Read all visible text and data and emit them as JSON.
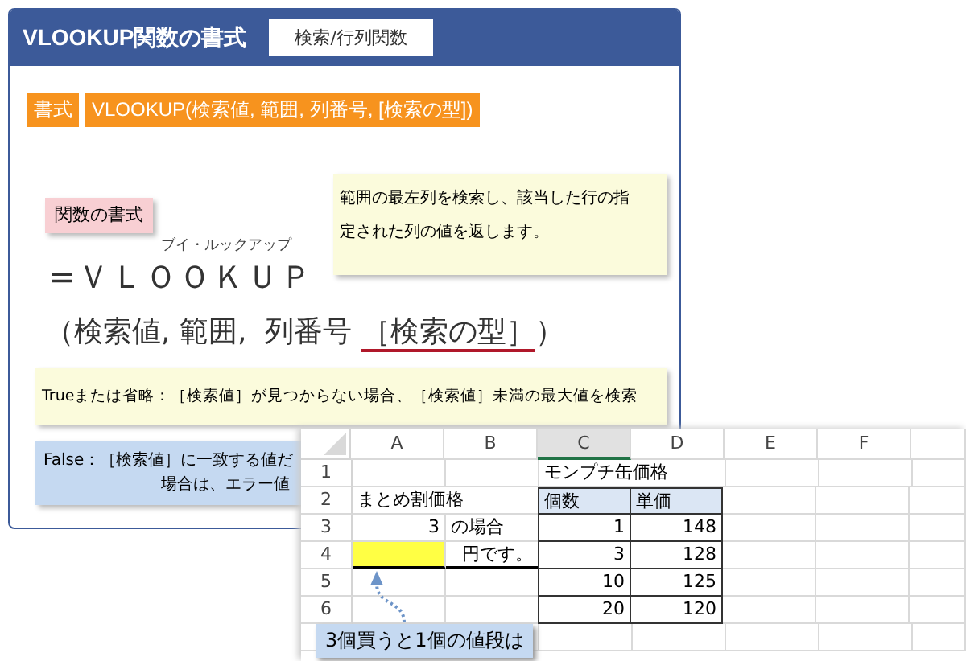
{
  "header": {
    "title": "VLOOKUP関数の書式",
    "tag": "検索/行列関数"
  },
  "syntax": {
    "label": "書式",
    "formula": "VLOOKUP(検索値, 範囲, 列番号, [検索の型])"
  },
  "heading_note": "関数の書式",
  "description_note": [
    "範囲の最左列を検索し、該当した行の指",
    "定された列の値を返します。"
  ],
  "furigana": "ブイ・ルックアップ",
  "function_name": "=ＶＬＯＯＫＵＰ",
  "arguments": [
    {
      "text": "（検索値, 範囲,  列番号 ",
      "underlined": false
    },
    {
      "text": "［検索の型］",
      "underlined": true
    },
    {
      "text": "）",
      "underlined": false
    }
  ],
  "true_note": "Trueまたは省略：［検索値］が見つからない場合、［検索値］未満の最大値を検索",
  "false_note": [
    "False：［検索値］に一致する値だ",
    "場合は、エラー値"
  ],
  "spreadsheet": {
    "columns": [
      {
        "label": "A",
        "selected": false
      },
      {
        "label": "B",
        "selected": false
      },
      {
        "label": "C",
        "selected": true
      },
      {
        "label": "D",
        "selected": false
      },
      {
        "label": "E",
        "selected": false
      },
      {
        "label": "F",
        "selected": false
      }
    ],
    "rows": [
      {
        "number": "1",
        "cells": [
          {
            "kind": "plain"
          },
          {
            "kind": "plain"
          },
          {
            "kind": "plain",
            "text": "モンプチ缶価格"
          },
          {
            "kind": "plain"
          },
          {
            "kind": "plain"
          },
          {
            "kind": "plain"
          }
        ]
      },
      {
        "number": "2",
        "cells": [
          {
            "kind": "plain",
            "text": "まとめ割価格"
          },
          {
            "kind": "plain"
          },
          {
            "kind": "header",
            "text": "個数"
          },
          {
            "kind": "header",
            "text": "単価"
          },
          {
            "kind": "plain"
          },
          {
            "kind": "plain"
          }
        ]
      },
      {
        "number": "3",
        "cells": [
          {
            "kind": "number",
            "text": "3"
          },
          {
            "kind": "plain",
            "text": "の場合"
          },
          {
            "kind": "table",
            "text": "1"
          },
          {
            "kind": "table",
            "text": "148"
          },
          {
            "kind": "plain"
          },
          {
            "kind": "plain"
          }
        ]
      },
      {
        "number": "4",
        "cells": [
          {
            "kind": "input"
          },
          {
            "kind": "number",
            "text": "円です。"
          },
          {
            "kind": "table",
            "text": "3"
          },
          {
            "kind": "table",
            "text": "128"
          },
          {
            "kind": "plain"
          },
          {
            "kind": "plain"
          }
        ]
      },
      {
        "number": "5",
        "cells": [
          {
            "kind": "plain"
          },
          {
            "kind": "plain"
          },
          {
            "kind": "table",
            "text": "10"
          },
          {
            "kind": "table",
            "text": "125"
          },
          {
            "kind": "plain"
          },
          {
            "kind": "plain"
          }
        ]
      },
      {
        "number": "6",
        "cells": [
          {
            "kind": "plain"
          },
          {
            "kind": "plain"
          },
          {
            "kind": "table",
            "text": "20"
          },
          {
            "kind": "table",
            "text": "120"
          },
          {
            "kind": "plain"
          },
          {
            "kind": "plain"
          }
        ]
      }
    ]
  },
  "callout": "3個買うと1個の値段は"
}
